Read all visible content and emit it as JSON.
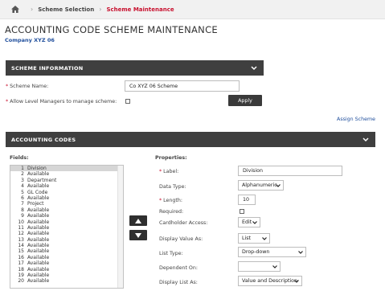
{
  "breadcrumb": {
    "items": [
      "Scheme Selection",
      "Scheme Maintenance"
    ]
  },
  "page": {
    "title": "ACCOUNTING CODE SCHEME MAINTENANCE",
    "company": "Company XYZ 06"
  },
  "scheme_info": {
    "header": "SCHEME INFORMATION",
    "scheme_name_label": "Scheme Name:",
    "scheme_name_value": "Co XYZ 06 Scheme",
    "allow_label": "Allow Level Managers to manage scheme:",
    "apply_label": "Apply"
  },
  "assign_link": "Assign Scheme",
  "accounting_codes": {
    "header": "ACCOUNTING CODES",
    "fields_label": "Fields:",
    "properties_label": "Properties:",
    "fields": [
      {
        "num": "1",
        "name": "Division"
      },
      {
        "num": "2",
        "name": "Available"
      },
      {
        "num": "3",
        "name": "Department"
      },
      {
        "num": "4",
        "name": "Available"
      },
      {
        "num": "5",
        "name": "GL Code"
      },
      {
        "num": "6",
        "name": "Available"
      },
      {
        "num": "7",
        "name": "Project"
      },
      {
        "num": "8",
        "name": "Available"
      },
      {
        "num": "9",
        "name": "Available"
      },
      {
        "num": "10",
        "name": "Available"
      },
      {
        "num": "11",
        "name": "Available"
      },
      {
        "num": "12",
        "name": "Available"
      },
      {
        "num": "13",
        "name": "Available"
      },
      {
        "num": "14",
        "name": "Available"
      },
      {
        "num": "15",
        "name": "Available"
      },
      {
        "num": "16",
        "name": "Available"
      },
      {
        "num": "17",
        "name": "Available"
      },
      {
        "num": "18",
        "name": "Available"
      },
      {
        "num": "19",
        "name": "Available"
      },
      {
        "num": "20",
        "name": "Available"
      }
    ],
    "properties": {
      "label_label": "Label:",
      "label_value": "Division",
      "data_type_label": "Data Type:",
      "data_type_value": "Alphanumeric",
      "length_label": "Length:",
      "length_value": "10",
      "required_label": "Required:",
      "cardholder_access_label": "Cardholder Access:",
      "cardholder_access_value": "Edit",
      "display_value_as_label": "Display Value As:",
      "display_value_as_value": "List",
      "list_type_label": "List Type:",
      "list_type_value": "Drop-down",
      "dependent_on_label": "Dependent On:",
      "dependent_on_value": "",
      "display_list_as_label": "Display List As:",
      "display_list_as_value": "Value and Description"
    }
  }
}
